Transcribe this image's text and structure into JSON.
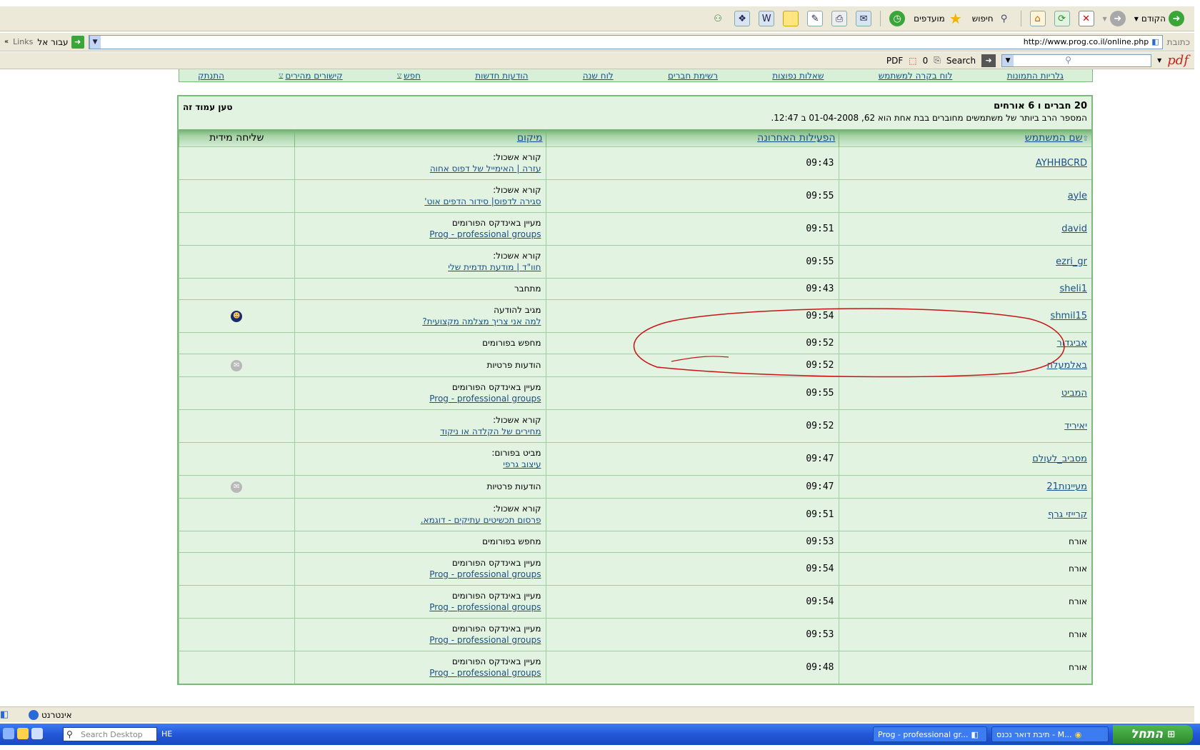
{
  "toolbar": {
    "back_label": "הקודם",
    "search_label": "חיפוש",
    "favorites_label": "מועדפים"
  },
  "address": {
    "label": "כתובת",
    "url": "http://www.prog.co.il/online.php",
    "go_label": "עבור אל",
    "links_label": "Links"
  },
  "pdfbar": {
    "logo": "pdf",
    "search_label": "Search",
    "count": "0",
    "pdf_label": "PDF"
  },
  "nav": {
    "items": [
      {
        "label": "גלריות התמונות"
      },
      {
        "label": "לוח בקרה למשתמש"
      },
      {
        "label": "שאלות נפוצות"
      },
      {
        "label": "רשימת חברים"
      },
      {
        "label": "לוח שנה"
      },
      {
        "label": "הודעות חדשות"
      },
      {
        "label": "חפש"
      },
      {
        "label": "קישורים מהירים"
      },
      {
        "label": "התנתק"
      }
    ]
  },
  "panel": {
    "title": "20 חברים ו 6 אורחים",
    "subtitle": "המספר הרב ביותר של משתמשים מחוברים בבת אחת הוא 62, 01-04-2008 ב 12:47.",
    "reload_label": "טען עמוד זה"
  },
  "table": {
    "headers": {
      "username": "שם המשתמש",
      "last_activity": "הפעילות האחרונה",
      "location": "מיקום",
      "instant_msg": "שליחה מידית"
    },
    "rows": [
      {
        "user": "AYHHBCRD",
        "time": "09:43",
        "loc1": "קורא אשכול:",
        "loc2": "עזרה | האימייל של דפוס אחוה",
        "pm": ""
      },
      {
        "user": "ayle",
        "time": "09:55",
        "loc1": "קורא אשכול:",
        "loc2": "סגירה לדפוס| סידור הדפים אוט'",
        "pm": ""
      },
      {
        "user": "david",
        "time": "09:51",
        "loc1": "מעיין באינדקס הפורומים",
        "loc2": "Prog - professional groups",
        "pm": ""
      },
      {
        "user": "ezri_gr",
        "time": "09:55",
        "loc1": "קורא אשכול:",
        "loc2": "חוו\"ד | מודעת תדמית שלי",
        "pm": ""
      },
      {
        "user": "sheli1",
        "time": "09:43",
        "loc1": "מתחבר",
        "loc2": "",
        "pm": ""
      },
      {
        "user": "shmil15",
        "time": "09:54",
        "loc1": "מגיב להודעה",
        "loc2": "למה אני צריך מצלמה מקצועית?",
        "pm": "user"
      },
      {
        "user": "אביגדור",
        "time": "09:52",
        "loc1": "מחפש בפורומים",
        "loc2": "",
        "pm": ""
      },
      {
        "user": "באלמעלה",
        "time": "09:52",
        "loc1": "הודעות פרטיות",
        "loc2": "",
        "pm": "msg"
      },
      {
        "user": "המביט",
        "time": "09:55",
        "loc1": "מעיין באינדקס הפורומים",
        "loc2": "Prog - professional groups",
        "pm": ""
      },
      {
        "user": "יאיריד",
        "time": "09:52",
        "loc1": "קורא אשכול:",
        "loc2": "מחירים של הקלדה או ניקוד",
        "pm": ""
      },
      {
        "user": "מסביב_לעולם",
        "time": "09:47",
        "loc1": "מביט בפורום:",
        "loc2": "עיצוב גרפי",
        "pm": ""
      },
      {
        "user": "מעיינות21",
        "time": "09:47",
        "loc1": "הודעות פרטיות",
        "loc2": "",
        "pm": "msg"
      },
      {
        "user": "קרייזי גרף",
        "time": "09:51",
        "loc1": "קורא אשכול:",
        "loc2": "פרסום תכשיטים עתיקים - דוגמא.",
        "pm": ""
      },
      {
        "user": "אורח",
        "time": "09:53",
        "loc1": "מחפש בפורומים",
        "loc2": "",
        "pm": ""
      },
      {
        "user": "אורח",
        "time": "09:54",
        "loc1": "מעיין באינדקס הפורומים",
        "loc2": "Prog - professional groups",
        "pm": ""
      },
      {
        "user": "אורח",
        "time": "09:54",
        "loc1": "מעיין באינדקס הפורומים",
        "loc2": "Prog - professional groups",
        "pm": ""
      },
      {
        "user": "אורח",
        "time": "09:53",
        "loc1": "מעיין באינדקס הפורומים",
        "loc2": "Prog - professional groups",
        "pm": ""
      },
      {
        "user": "אורח",
        "time": "09:48",
        "loc1": "מעיין באינדקס הפורומים",
        "loc2": "Prog - professional groups",
        "pm": ""
      }
    ]
  },
  "status": {
    "zone": "אינטרנט"
  },
  "taskbar": {
    "start_label": "התחל",
    "task1": "תיבת דואר נכנס - M...",
    "task2": "Prog - professional gr...",
    "search_placeholder": "Search Desktop",
    "lang": "HE"
  }
}
